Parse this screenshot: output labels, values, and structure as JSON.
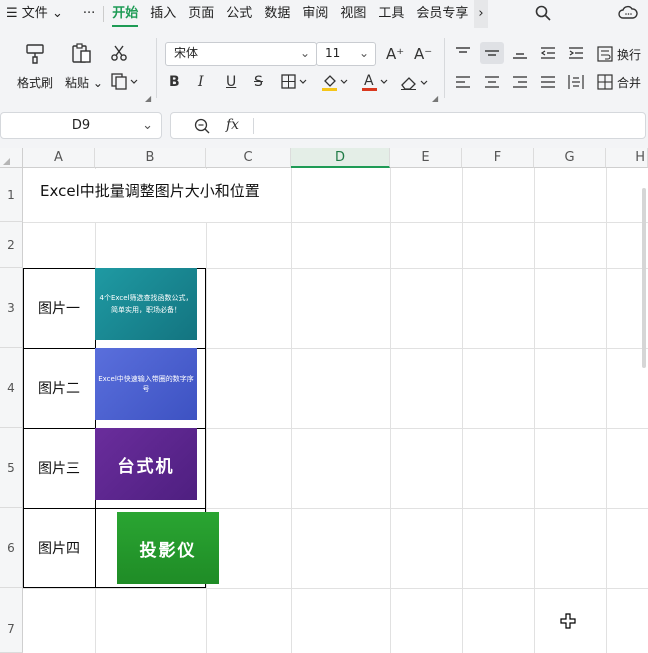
{
  "menubar": {
    "file": "文件",
    "more": "···",
    "tabs": [
      "开始",
      "插入",
      "页面",
      "公式",
      "数据",
      "审阅",
      "视图",
      "工具",
      "会员专享"
    ],
    "chevron": "›"
  },
  "ribbon": {
    "format_painter": "格式刷",
    "paste": "粘贴",
    "font_name": "宋体",
    "font_size": "11",
    "wrap": "换行",
    "merge": "合并",
    "bold": "B",
    "italic": "I",
    "underline": "U",
    "strike": "S",
    "font_color_letter": "A",
    "grow_font": "A⁺",
    "shrink_font": "A⁻"
  },
  "formula_bar": {
    "name_box": "D9",
    "fx": "fx",
    "formula": ""
  },
  "columns": [
    "A",
    "B",
    "C",
    "D",
    "E",
    "F",
    "G",
    "H"
  ],
  "rows": [
    "1",
    "2",
    "3",
    "4",
    "5",
    "6",
    "7"
  ],
  "cells": {
    "title": "Excel中批量调整图片大小和位置",
    "labels": [
      "图片一",
      "图片二",
      "图片三",
      "图片四"
    ]
  },
  "images": [
    {
      "text": "4个Excel筛选查找函数公式，简单实用，职场必备！",
      "color": "#1a8c96"
    },
    {
      "text": "Excel中快速输入带圈的数字序号",
      "color": "#4a5fcf"
    },
    {
      "text": "台式机",
      "color": "#5e2a8f"
    },
    {
      "text": "投影仪",
      "color": "#239b2c"
    }
  ],
  "colors": {
    "accent": "#1e9b55",
    "fill_bucket": "#f5c518",
    "font_color": "#d9381e"
  },
  "icons": [
    "search-icon",
    "cloud-icon",
    "scissors-icon",
    "zoom-icon",
    "crosshair-icon"
  ]
}
